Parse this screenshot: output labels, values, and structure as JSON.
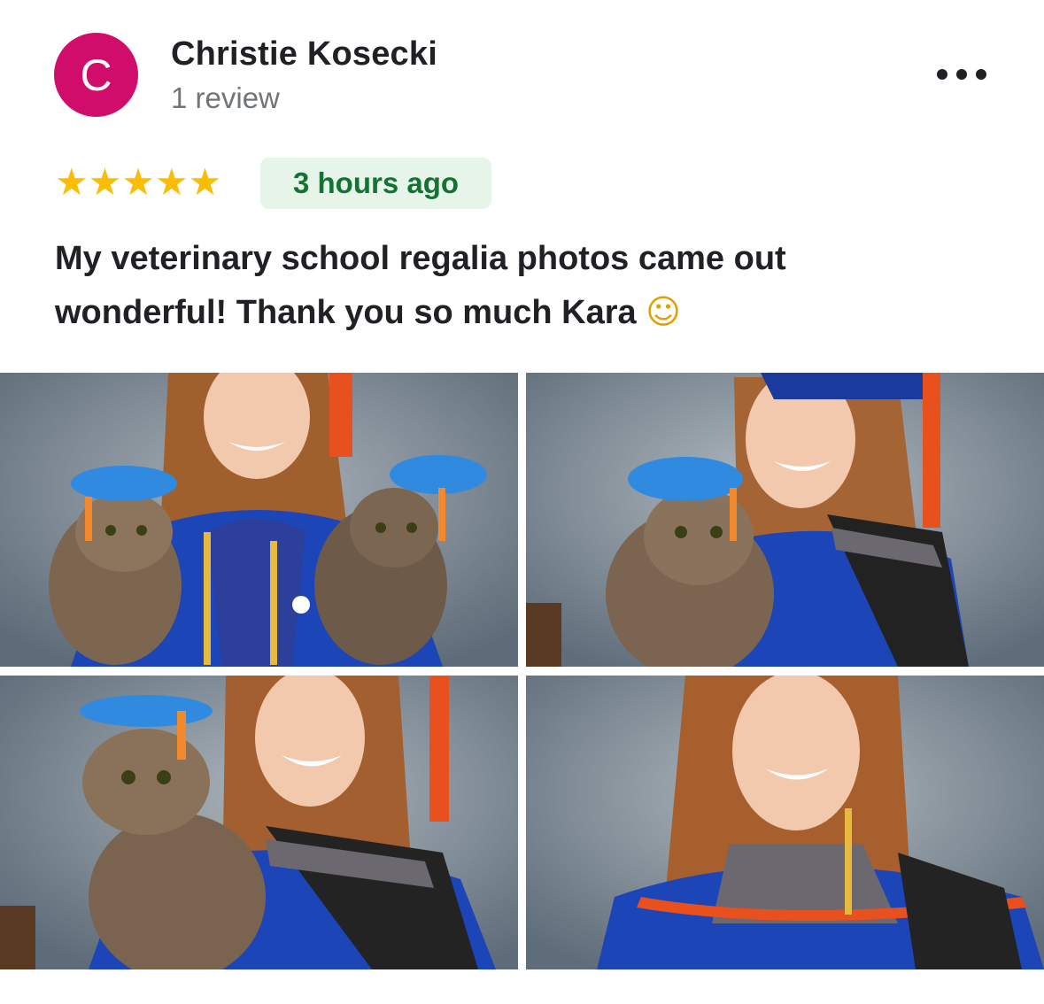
{
  "reviewer": {
    "initial": "C",
    "name": "Christie Kosecki",
    "review_count": "1 review",
    "avatar_color": "#d10d6b"
  },
  "review": {
    "rating": 5,
    "stars": "★★★★★",
    "time": "3 hours ago",
    "text_line1": "My veterinary school regalia photos came out",
    "text_line2": "wonderful! Thank you so much Kara",
    "emoji": "☺"
  },
  "menu_icon": "more-horizontal-icon",
  "photos": [
    {
      "name": "review-photo-1"
    },
    {
      "name": "review-photo-2"
    },
    {
      "name": "review-photo-3"
    },
    {
      "name": "review-photo-4"
    }
  ],
  "colors": {
    "star": "#fbbc04",
    "badge_bg": "#e6f4ea",
    "badge_text": "#137333",
    "gown": "#1c45b8",
    "cap": "#2f8ae0",
    "tassel": "#e8501e"
  }
}
